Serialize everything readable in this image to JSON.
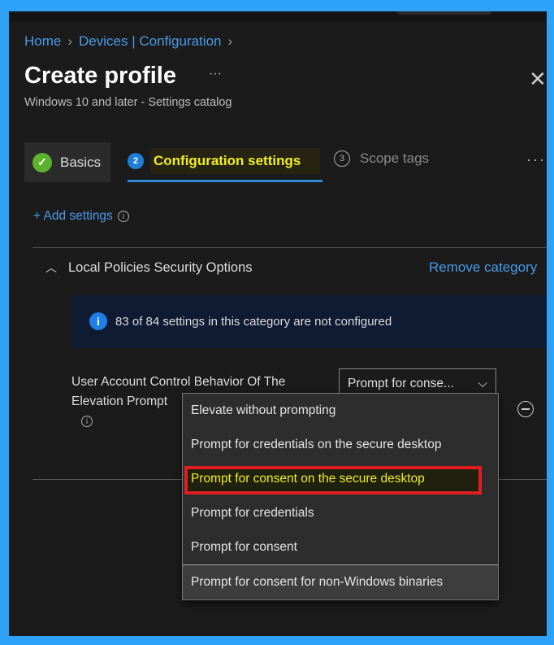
{
  "breadcrumb": {
    "items": [
      "Home",
      "Devices | Configuration"
    ]
  },
  "header": {
    "title": "Create profile",
    "more": "···",
    "close": "✕",
    "subtitle": "Windows 10 and later - Settings catalog"
  },
  "tabs": [
    {
      "label": "Basics",
      "state": "complete"
    },
    {
      "number": "2",
      "label": "Configuration settings",
      "state": "active"
    },
    {
      "number": "3",
      "label": "Scope tags",
      "state": "inactive"
    }
  ],
  "tabs_more": "···",
  "add_settings": "+ Add settings",
  "category": {
    "title": "Local Policies Security Options",
    "remove": "Remove category",
    "banner": "83 of 84 settings in this category are not configured"
  },
  "setting": {
    "label": "User Account Control Behavior Of The Elevation Prompt",
    "value": "Prompt for conse...",
    "options": [
      "Elevate without prompting",
      "Prompt for credentials on the secure desktop",
      "Prompt for consent on the secure desktop",
      "Prompt for credentials",
      "Prompt for consent",
      "Prompt for consent for non-Windows binaries"
    ]
  },
  "colors": {
    "accent": "#4a9be8",
    "highlight": "#f2ef1c",
    "annotation": "#e01e22"
  }
}
